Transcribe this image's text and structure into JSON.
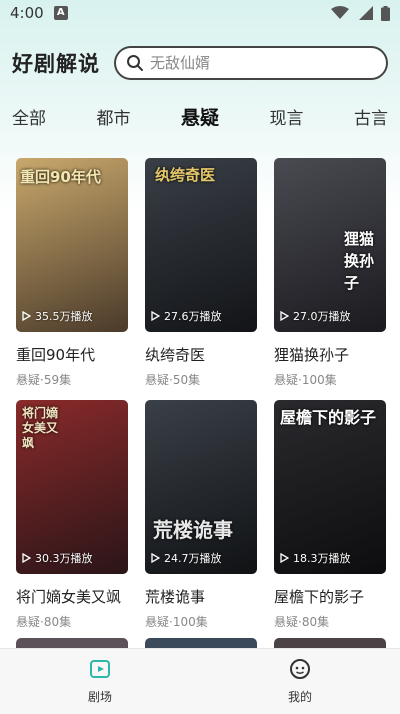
{
  "status_bar": {
    "time": "4:00",
    "notification_badge": "A"
  },
  "header": {
    "title": "好剧解说",
    "search_placeholder": "无敌仙婿"
  },
  "tabs": [
    {
      "label": "全部",
      "active": false
    },
    {
      "label": "都市",
      "active": false
    },
    {
      "label": "悬疑",
      "active": true
    },
    {
      "label": "现言",
      "active": false
    },
    {
      "label": "古言",
      "active": false
    }
  ],
  "cards": [
    {
      "title": "重回90年代",
      "meta": "悬疑·59集",
      "plays": "35.5万播放",
      "poster_text": "重回90年代",
      "poster_colors": [
        "#c9a86c",
        "#4a3a2a"
      ]
    },
    {
      "title": "纨绔奇医",
      "meta": "悬疑·50集",
      "plays": "27.6万播放",
      "poster_text": "纨绔奇医",
      "poster_colors": [
        "#3a3f47",
        "#121417"
      ]
    },
    {
      "title": "狸猫换孙子",
      "meta": "悬疑·100集",
      "plays": "27.0万播放",
      "poster_text": "狸猫换孙子",
      "poster_colors": [
        "#4a4a52",
        "#1a1a1f"
      ]
    },
    {
      "title": "将门嫡女美又飒",
      "meta": "悬疑·80集",
      "plays": "30.3万播放",
      "poster_text": "将门嫡女美又飒",
      "poster_colors": [
        "#8a2a2a",
        "#2a1518"
      ]
    },
    {
      "title": "荒楼诡事",
      "meta": "悬疑·100集",
      "plays": "24.7万播放",
      "poster_text": "荒楼诡事",
      "poster_colors": [
        "#3a4048",
        "#101214"
      ]
    },
    {
      "title": "屋檐下的影子",
      "meta": "悬疑·80集",
      "plays": "18.3万播放",
      "poster_text": "屋檐下的影子",
      "poster_colors": [
        "#2a2a2e",
        "#0d0d0f"
      ]
    }
  ],
  "bottom_nav": [
    {
      "label": "剧场",
      "icon": "theater-icon",
      "active": true
    },
    {
      "label": "我的",
      "icon": "profile-icon",
      "active": false
    }
  ],
  "colors": {
    "accent": "#2bb8a8"
  }
}
